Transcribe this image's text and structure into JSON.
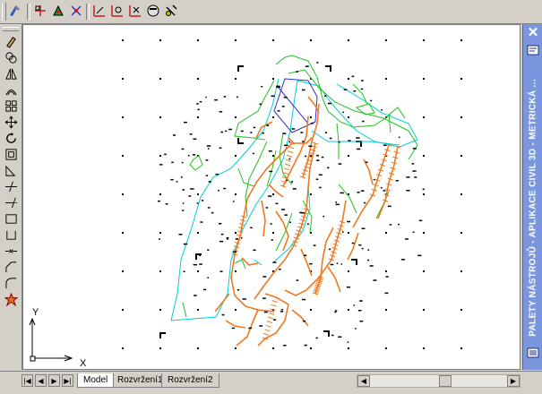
{
  "app": {
    "colors": {
      "background": "#ffffff",
      "palette": "#7a96df",
      "chrome": "#d4d0c8"
    }
  },
  "top_toolbar": {
    "icons": [
      "properties-icon",
      "osnap-endpoint-icon",
      "osnap-midpoint-icon",
      "osnap-intersection-icon",
      "osnap-extension-icon",
      "osnap-center-icon",
      "osnap-quadrant-icon",
      "osnap-tangent-icon",
      "osnap-none-icon"
    ]
  },
  "left_toolbar": {
    "icons": [
      "erase-icon",
      "copy-icon",
      "mirror-icon",
      "offset-icon",
      "array-icon",
      "move-icon",
      "rotate-icon",
      "scale-icon",
      "stretch-icon",
      "trim-icon",
      "extend-icon",
      "break-icon",
      "break-at-point-icon",
      "join-icon",
      "chamfer-icon",
      "fillet-icon",
      "explode-icon"
    ]
  },
  "palette": {
    "title": "PALETY NÁSTROJŮ - APLIKACE CIVIL 3D - METRICKÁ ..."
  },
  "ucs": {
    "y_label": "Y",
    "x_label": "X"
  },
  "tabs": [
    {
      "label": "Model",
      "active": true
    },
    {
      "label": "Rozvržení1",
      "active": false
    },
    {
      "label": "Rozvržení2",
      "active": false
    }
  ]
}
